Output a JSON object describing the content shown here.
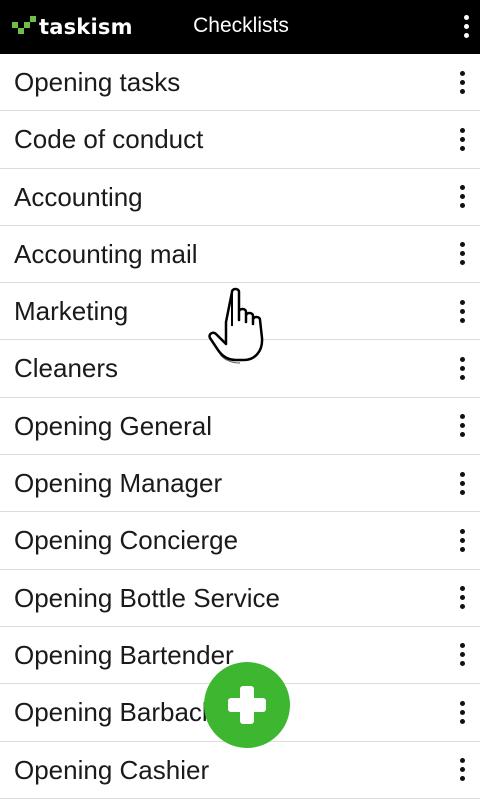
{
  "app_bar": {
    "logo_text": "taskism",
    "title": "Checklists",
    "menu_icon": "more-vert-icon"
  },
  "checklists": [
    {
      "label": "Opening tasks"
    },
    {
      "label": "Code of conduct"
    },
    {
      "label": "Accounting"
    },
    {
      "label": "Accounting mail"
    },
    {
      "label": "Marketing"
    },
    {
      "label": "Cleaners"
    },
    {
      "label": "Opening General"
    },
    {
      "label": "Opening Manager"
    },
    {
      "label": "Opening Concierge"
    },
    {
      "label": "Opening Bottle Service"
    },
    {
      "label": "Opening Bartender"
    },
    {
      "label": "Opening Barback"
    },
    {
      "label": "Opening Cashier"
    }
  ],
  "row_menu_icon": "more-vert-icon",
  "fab": {
    "icon": "plus-icon"
  },
  "pointer": {
    "icon": "hand-pointer-icon"
  },
  "colors": {
    "app_bar": "#000000",
    "brand_green": "#6cc04a",
    "fab_green": "#3cb72f",
    "divider": "#dcdcdc",
    "text": "#1a1a1a"
  }
}
